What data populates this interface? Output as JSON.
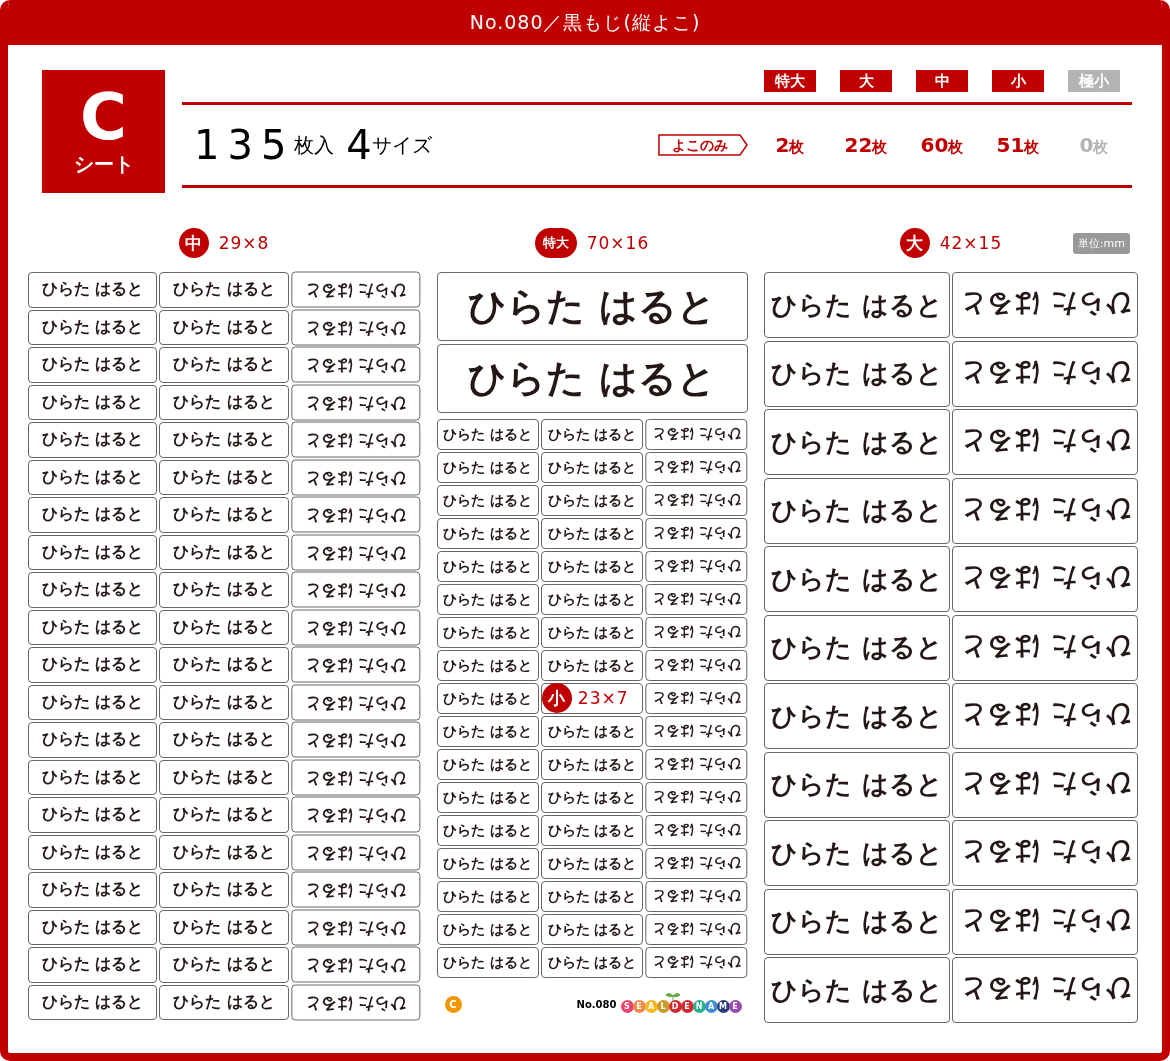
{
  "title": "No.080／黒もじ(縦よこ)",
  "sheet_badge": {
    "letter": "C",
    "label": "シート"
  },
  "size_tags": [
    {
      "label": "特大",
      "disabled": false
    },
    {
      "label": "大",
      "disabled": false
    },
    {
      "label": "中",
      "disabled": false
    },
    {
      "label": "小",
      "disabled": false
    },
    {
      "label": "極小",
      "disabled": true
    }
  ],
  "summary": {
    "count": "135",
    "count_unit": "枚入",
    "sizes": "4",
    "sizes_unit": "サイズ"
  },
  "orientation_tag": "よこのみ",
  "counts": [
    {
      "number": "2",
      "unit": "枚",
      "disabled": false
    },
    {
      "number": "22",
      "unit": "枚",
      "disabled": false
    },
    {
      "number": "60",
      "unit": "枚",
      "disabled": false
    },
    {
      "number": "51",
      "unit": "枚",
      "disabled": false
    },
    {
      "number": "0",
      "unit": "枚",
      "disabled": true
    }
  ],
  "columns": [
    {
      "heading": {
        "tag": "中",
        "dimensions": "29×8"
      },
      "sections": [
        {
          "kind": "medium",
          "rows": [
            [
              {
                "kind": "label",
                "text": "ひらた はると",
                "flipped": false
              },
              {
                "kind": "label",
                "text": "ひらた はると",
                "flipped": false
              },
              {
                "kind": "label",
                "text": "ひらた はると",
                "flipped": true
              }
            ],
            [
              {
                "kind": "label",
                "text": "ひらた はると",
                "flipped": false
              },
              {
                "kind": "label",
                "text": "ひらた はると",
                "flipped": false
              },
              {
                "kind": "label",
                "text": "ひらた はると",
                "flipped": true
              }
            ],
            [
              {
                "kind": "label",
                "text": "ひらた はると",
                "flipped": false
              },
              {
                "kind": "label",
                "text": "ひらた はると",
                "flipped": false
              },
              {
                "kind": "label",
                "text": "ひらた はると",
                "flipped": true
              }
            ],
            [
              {
                "kind": "label",
                "text": "ひらた はると",
                "flipped": false
              },
              {
                "kind": "label",
                "text": "ひらた はると",
                "flipped": false
              },
              {
                "kind": "label",
                "text": "ひらた はると",
                "flipped": true
              }
            ],
            [
              {
                "kind": "label",
                "text": "ひらた はると",
                "flipped": false
              },
              {
                "kind": "label",
                "text": "ひらた はると",
                "flipped": false
              },
              {
                "kind": "label",
                "text": "ひらた はると",
                "flipped": true
              }
            ],
            [
              {
                "kind": "label",
                "text": "ひらた はると",
                "flipped": false
              },
              {
                "kind": "label",
                "text": "ひらた はると",
                "flipped": false
              },
              {
                "kind": "label",
                "text": "ひらた はると",
                "flipped": true
              }
            ],
            [
              {
                "kind": "label",
                "text": "ひらた はると",
                "flipped": false
              },
              {
                "kind": "label",
                "text": "ひらた はると",
                "flipped": false
              },
              {
                "kind": "label",
                "text": "ひらた はると",
                "flipped": true
              }
            ],
            [
              {
                "kind": "label",
                "text": "ひらた はると",
                "flipped": false
              },
              {
                "kind": "label",
                "text": "ひらた はると",
                "flipped": false
              },
              {
                "kind": "label",
                "text": "ひらた はると",
                "flipped": true
              }
            ],
            [
              {
                "kind": "label",
                "text": "ひらた はると",
                "flipped": false
              },
              {
                "kind": "label",
                "text": "ひらた はると",
                "flipped": false
              },
              {
                "kind": "label",
                "text": "ひらた はると",
                "flipped": true
              }
            ],
            [
              {
                "kind": "label",
                "text": "ひらた はると",
                "flipped": false
              },
              {
                "kind": "label",
                "text": "ひらた はると",
                "flipped": false
              },
              {
                "kind": "label",
                "text": "ひらた はると",
                "flipped": true
              }
            ],
            [
              {
                "kind": "label",
                "text": "ひらた はると",
                "flipped": false
              },
              {
                "kind": "label",
                "text": "ひらた はると",
                "flipped": false
              },
              {
                "kind": "label",
                "text": "ひらた はると",
                "flipped": true
              }
            ],
            [
              {
                "kind": "label",
                "text": "ひらた はると",
                "flipped": false
              },
              {
                "kind": "label",
                "text": "ひらた はると",
                "flipped": false
              },
              {
                "kind": "label",
                "text": "ひらた はると",
                "flipped": true
              }
            ],
            [
              {
                "kind": "label",
                "text": "ひらた はると",
                "flipped": false
              },
              {
                "kind": "label",
                "text": "ひらた はると",
                "flipped": false
              },
              {
                "kind": "label",
                "text": "ひらた はると",
                "flipped": true
              }
            ],
            [
              {
                "kind": "label",
                "text": "ひらた はると",
                "flipped": false
              },
              {
                "kind": "label",
                "text": "ひらた はると",
                "flipped": false
              },
              {
                "kind": "label",
                "text": "ひらた はると",
                "flipped": true
              }
            ],
            [
              {
                "kind": "label",
                "text": "ひらた はると",
                "flipped": false
              },
              {
                "kind": "label",
                "text": "ひらた はると",
                "flipped": false
              },
              {
                "kind": "label",
                "text": "ひらた はると",
                "flipped": true
              }
            ],
            [
              {
                "kind": "label",
                "text": "ひらた はると",
                "flipped": false
              },
              {
                "kind": "label",
                "text": "ひらた はると",
                "flipped": false
              },
              {
                "kind": "label",
                "text": "ひらた はると",
                "flipped": true
              }
            ],
            [
              {
                "kind": "label",
                "text": "ひらた はると",
                "flipped": false
              },
              {
                "kind": "label",
                "text": "ひらた はると",
                "flipped": false
              },
              {
                "kind": "label",
                "text": "ひらた はると",
                "flipped": true
              }
            ],
            [
              {
                "kind": "label",
                "text": "ひらた はると",
                "flipped": false
              },
              {
                "kind": "label",
                "text": "ひらた はると",
                "flipped": false
              },
              {
                "kind": "label",
                "text": "ひらた はると",
                "flipped": true
              }
            ],
            [
              {
                "kind": "label",
                "text": "ひらた はると",
                "flipped": false
              },
              {
                "kind": "label",
                "text": "ひらた はると",
                "flipped": false
              },
              {
                "kind": "label",
                "text": "ひらた はると",
                "flipped": true
              }
            ],
            [
              {
                "kind": "label",
                "text": "ひらた はると",
                "flipped": false
              },
              {
                "kind": "label",
                "text": "ひらた はると",
                "flipped": false
              },
              {
                "kind": "label",
                "text": "ひらた はると",
                "flipped": true
              }
            ]
          ]
        }
      ]
    },
    {
      "heading": {
        "tag": "特大",
        "dimensions": "70×16"
      },
      "sections": [
        {
          "kind": "xl",
          "rows": [
            [
              {
                "kind": "label",
                "text": "ひらた はると",
                "flipped": false
              }
            ],
            [
              {
                "kind": "label",
                "text": "ひらた はると",
                "flipped": false
              }
            ]
          ]
        },
        {
          "kind": "small",
          "rows": [
            [
              {
                "kind": "label",
                "text": "ひらた はると",
                "flipped": false
              },
              {
                "kind": "label",
                "text": "ひらた はると",
                "flipped": false
              },
              {
                "kind": "label",
                "text": "ひらた はると",
                "flipped": true
              }
            ],
            [
              {
                "kind": "label",
                "text": "ひらた はると",
                "flipped": false
              },
              {
                "kind": "label",
                "text": "ひらた はると",
                "flipped": false
              },
              {
                "kind": "label",
                "text": "ひらた はると",
                "flipped": true
              }
            ],
            [
              {
                "kind": "label",
                "text": "ひらた はると",
                "flipped": false
              },
              {
                "kind": "label",
                "text": "ひらた はると",
                "flipped": false
              },
              {
                "kind": "label",
                "text": "ひらた はると",
                "flipped": true
              }
            ],
            [
              {
                "kind": "label",
                "text": "ひらた はると",
                "flipped": false
              },
              {
                "kind": "label",
                "text": "ひらた はると",
                "flipped": false
              },
              {
                "kind": "label",
                "text": "ひらた はると",
                "flipped": true
              }
            ],
            [
              {
                "kind": "label",
                "text": "ひらた はると",
                "flipped": false
              },
              {
                "kind": "label",
                "text": "ひらた はると",
                "flipped": false
              },
              {
                "kind": "label",
                "text": "ひらた はると",
                "flipped": true
              }
            ],
            [
              {
                "kind": "label",
                "text": "ひらた はると",
                "flipped": false
              },
              {
                "kind": "label",
                "text": "ひらた はると",
                "flipped": false
              },
              {
                "kind": "label",
                "text": "ひらた はると",
                "flipped": true
              }
            ],
            [
              {
                "kind": "label",
                "text": "ひらた はると",
                "flipped": false
              },
              {
                "kind": "label",
                "text": "ひらた はると",
                "flipped": false
              },
              {
                "kind": "label",
                "text": "ひらた はると",
                "flipped": true
              }
            ],
            [
              {
                "kind": "label",
                "text": "ひらた はると",
                "flipped": false
              },
              {
                "kind": "label",
                "text": "ひらた はると",
                "flipped": false
              },
              {
                "kind": "label",
                "text": "ひらた はると",
                "flipped": true
              }
            ],
            [
              {
                "kind": "label",
                "text": "ひらた はると",
                "flipped": false
              },
              {
                "kind": "tag",
                "tag": "小",
                "dimensions": "23×7"
              },
              {
                "kind": "label",
                "text": "ひらた はると",
                "flipped": true
              }
            ],
            [
              {
                "kind": "label",
                "text": "ひらた はると",
                "flipped": false
              },
              {
                "kind": "label",
                "text": "ひらた はると",
                "flipped": false
              },
              {
                "kind": "label",
                "text": "ひらた はると",
                "flipped": true
              }
            ],
            [
              {
                "kind": "label",
                "text": "ひらた はると",
                "flipped": false
              },
              {
                "kind": "label",
                "text": "ひらた はると",
                "flipped": false
              },
              {
                "kind": "label",
                "text": "ひらた はると",
                "flipped": true
              }
            ],
            [
              {
                "kind": "label",
                "text": "ひらた はると",
                "flipped": false
              },
              {
                "kind": "label",
                "text": "ひらた はると",
                "flipped": false
              },
              {
                "kind": "label",
                "text": "ひらた はると",
                "flipped": true
              }
            ],
            [
              {
                "kind": "label",
                "text": "ひらた はると",
                "flipped": false
              },
              {
                "kind": "label",
                "text": "ひらた はると",
                "flipped": false
              },
              {
                "kind": "label",
                "text": "ひらた はると",
                "flipped": true
              }
            ],
            [
              {
                "kind": "label",
                "text": "ひらた はると",
                "flipped": false
              },
              {
                "kind": "label",
                "text": "ひらた はると",
                "flipped": false
              },
              {
                "kind": "label",
                "text": "ひらた はると",
                "flipped": true
              }
            ],
            [
              {
                "kind": "label",
                "text": "ひらた はると",
                "flipped": false
              },
              {
                "kind": "label",
                "text": "ひらた はると",
                "flipped": false
              },
              {
                "kind": "label",
                "text": "ひらた はると",
                "flipped": true
              }
            ],
            [
              {
                "kind": "label",
                "text": "ひらた はると",
                "flipped": false
              },
              {
                "kind": "label",
                "text": "ひらた はると",
                "flipped": false
              },
              {
                "kind": "label",
                "text": "ひらた はると",
                "flipped": true
              }
            ],
            [
              {
                "kind": "label",
                "text": "ひらた はると",
                "flipped": false
              },
              {
                "kind": "label",
                "text": "ひらた はると",
                "flipped": false
              },
              {
                "kind": "label",
                "text": "ひらた はると",
                "flipped": true
              }
            ]
          ]
        }
      ],
      "footer": {
        "sheet_mark": "C",
        "number": "No.080",
        "logo": [
          {
            "letter": "S",
            "color": "#e8426e"
          },
          {
            "letter": "E",
            "color": "#f08a4b"
          },
          {
            "letter": "A",
            "color": "#f5b91c"
          },
          {
            "letter": "L",
            "color": "#c79a2a"
          },
          {
            "letter": "D",
            "color": "#d12b2f"
          },
          {
            "letter": "E",
            "color": "#d12b2f"
          },
          {
            "letter": "N",
            "color": "#2bb08f"
          },
          {
            "letter": "A",
            "color": "#3f8fd0"
          },
          {
            "letter": "M",
            "color": "#2b3a78"
          },
          {
            "letter": "E",
            "color": "#9a4bb0"
          }
        ]
      }
    },
    {
      "heading": {
        "tag": "大",
        "dimensions": "42×15",
        "unit": "単位:mm"
      },
      "sections": [
        {
          "kind": "large",
          "rows": [
            [
              {
                "kind": "label",
                "text": "ひらた はると",
                "flipped": false
              },
              {
                "kind": "label",
                "text": "ひらた はると",
                "flipped": true
              }
            ],
            [
              {
                "kind": "label",
                "text": "ひらた はると",
                "flipped": false
              },
              {
                "kind": "label",
                "text": "ひらた はると",
                "flipped": true
              }
            ],
            [
              {
                "kind": "label",
                "text": "ひらた はると",
                "flipped": false
              },
              {
                "kind": "label",
                "text": "ひらた はると",
                "flipped": true
              }
            ],
            [
              {
                "kind": "label",
                "text": "ひらた はると",
                "flipped": false
              },
              {
                "kind": "label",
                "text": "ひらた はると",
                "flipped": true
              }
            ],
            [
              {
                "kind": "label",
                "text": "ひらた はると",
                "flipped": false
              },
              {
                "kind": "label",
                "text": "ひらた はると",
                "flipped": true
              }
            ],
            [
              {
                "kind": "label",
                "text": "ひらた はると",
                "flipped": false
              },
              {
                "kind": "label",
                "text": "ひらた はると",
                "flipped": true
              }
            ],
            [
              {
                "kind": "label",
                "text": "ひらた はると",
                "flipped": false
              },
              {
                "kind": "label",
                "text": "ひらた はると",
                "flipped": true
              }
            ],
            [
              {
                "kind": "label",
                "text": "ひらた はると",
                "flipped": false
              },
              {
                "kind": "label",
                "text": "ひらた はると",
                "flipped": true
              }
            ],
            [
              {
                "kind": "label",
                "text": "ひらた はると",
                "flipped": false
              },
              {
                "kind": "label",
                "text": "ひらた はると",
                "flipped": true
              }
            ],
            [
              {
                "kind": "label",
                "text": "ひらた はると",
                "flipped": false
              },
              {
                "kind": "label",
                "text": "ひらた はると",
                "flipped": true
              }
            ],
            [
              {
                "kind": "label",
                "text": "ひらた はると",
                "flipped": false
              },
              {
                "kind": "label",
                "text": "ひらた はると",
                "flipped": true
              }
            ]
          ]
        }
      ]
    }
  ]
}
